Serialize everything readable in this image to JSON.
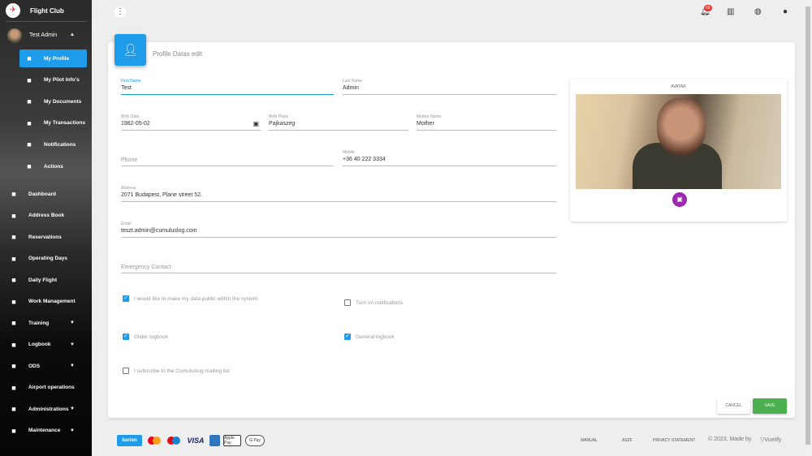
{
  "sidebar": {
    "brand": "Flight Club",
    "user": "Test Admin",
    "user_items": [
      {
        "label": "My Profile",
        "icon": "person-icon",
        "active": true
      },
      {
        "label": "My Pilot Info's",
        "icon": "shield-plus-icon"
      },
      {
        "label": "My Documents",
        "icon": "document-icon"
      },
      {
        "label": "My Transactions",
        "icon": "cash-icon"
      },
      {
        "label": "Notifications",
        "icon": "bell-icon"
      },
      {
        "label": "Actions",
        "icon": "gear-icon"
      }
    ],
    "nav_items": [
      {
        "label": "Dashboard",
        "icon": "dashboard-icon"
      },
      {
        "label": "Address Book",
        "icon": "contacts-icon"
      },
      {
        "label": "Reservations",
        "icon": "calendar-icon"
      },
      {
        "label": "Operating Days",
        "icon": "calendar-event-icon"
      },
      {
        "label": "Daily Flight",
        "icon": "timer-icon"
      },
      {
        "label": "Work Management",
        "icon": "cart-icon"
      },
      {
        "label": "Training",
        "icon": "notebook-icon",
        "expand": true
      },
      {
        "label": "Logbook",
        "icon": "book-icon",
        "expand": true
      },
      {
        "label": "ODS",
        "icon": "plane-landing-icon",
        "expand": true
      },
      {
        "label": "Airport operations",
        "icon": "airport-icon"
      },
      {
        "label": "Administrations",
        "icon": "gear-icon",
        "expand": true
      },
      {
        "label": "Maintenance",
        "icon": "tools-icon",
        "expand": true
      }
    ]
  },
  "topbar": {
    "notification_count": "69"
  },
  "card": {
    "title": "Profile Datas edit",
    "fields": {
      "first_name": {
        "label": "First Name",
        "value": "Test"
      },
      "last_name": {
        "label": "Last Name",
        "value": "Admin"
      },
      "birth_date": {
        "label": "Birth Date",
        "value": "1982-05-02"
      },
      "birth_place": {
        "label": "Birth Place",
        "value": "Pajkaszeg"
      },
      "mother_name": {
        "label": "Mother Name",
        "value": "Mother"
      },
      "phone": {
        "placeholder": "Phone"
      },
      "mobile": {
        "label": "Mobile",
        "value": "+36 40 222 3334"
      },
      "address": {
        "label": "Address",
        "value": "2071 Budapest, Plane street 52."
      },
      "email": {
        "label": "Email",
        "value": "teszt.admin@cumuluslog.com"
      },
      "emergency": {
        "placeholder": "Emergency Contact"
      }
    },
    "checkboxes": {
      "public": {
        "label": "I would like to make my data public within the system",
        "checked": true
      },
      "notifications": {
        "label": "Turn on notifications",
        "checked": false
      },
      "glider": {
        "label": "Glider logbook",
        "checked": true
      },
      "general": {
        "label": "General logbook",
        "checked": true
      },
      "mailing": {
        "label": "I subscribe to the Cumuluslog mailing list",
        "checked": false
      }
    },
    "avatar_label": "AVATAR",
    "cancel": "CANCEL",
    "save": "SAVE"
  },
  "footer": {
    "payments": [
      "barion",
      "Mastercard",
      "Maestro",
      "VISA",
      "Amex",
      "Apple Pay",
      "G Pay"
    ],
    "links": [
      "MANUAL",
      "ASZF",
      "PRIVACY STATEMENT"
    ],
    "made_by": "© 2023, Made by",
    "vuetify": "Vuetify"
  },
  "colors": {
    "primary": "#1e9be9",
    "save": "#4caf50",
    "avatar_button": "#9c27b0",
    "badge": "#e53935"
  }
}
